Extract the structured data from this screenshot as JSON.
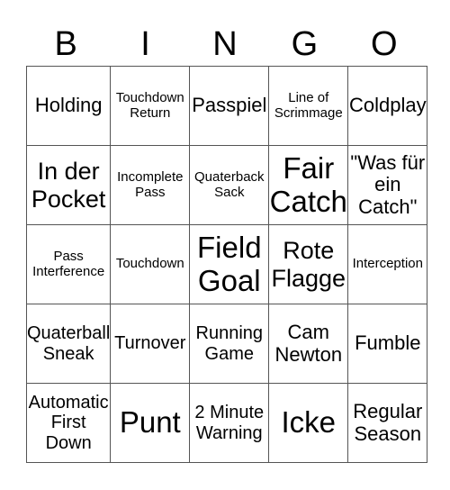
{
  "header": [
    "B",
    "I",
    "N",
    "G",
    "O"
  ],
  "rows": [
    [
      {
        "text": "Holding",
        "size": "s3"
      },
      {
        "text": "Touchdown Return",
        "size": "s1"
      },
      {
        "text": "Passpiel",
        "size": "s3"
      },
      {
        "text": "Line of Scrimmage",
        "size": "s1"
      },
      {
        "text": "Coldplay",
        "size": "s3"
      }
    ],
    [
      {
        "text": "In der Pocket",
        "size": "s4"
      },
      {
        "text": "Incomplete Pass",
        "size": "s1"
      },
      {
        "text": "Quaterback Sack",
        "size": "s1"
      },
      {
        "text": "Fair Catch",
        "size": "s5"
      },
      {
        "text": "\"Was für ein Catch\"",
        "size": "s3"
      }
    ],
    [
      {
        "text": "Pass Interference",
        "size": "s1"
      },
      {
        "text": "Touchdown",
        "size": "s1"
      },
      {
        "text": "Field Goal",
        "size": "s5"
      },
      {
        "text": "Rote Flagge",
        "size": "s4"
      },
      {
        "text": "Interception",
        "size": "s1"
      }
    ],
    [
      {
        "text": "Quaterball Sneak",
        "size": "s2"
      },
      {
        "text": "Turnover",
        "size": "s2"
      },
      {
        "text": "Running Game",
        "size": "s2"
      },
      {
        "text": "Cam Newton",
        "size": "s3"
      },
      {
        "text": "Fumble",
        "size": "s3"
      }
    ],
    [
      {
        "text": "Automatic First Down",
        "size": "s2"
      },
      {
        "text": "Punt",
        "size": "s5"
      },
      {
        "text": "2 Minute Warning",
        "size": "s2"
      },
      {
        "text": "Icke",
        "size": "s5"
      },
      {
        "text": "Regular Season",
        "size": "s3"
      }
    ]
  ]
}
